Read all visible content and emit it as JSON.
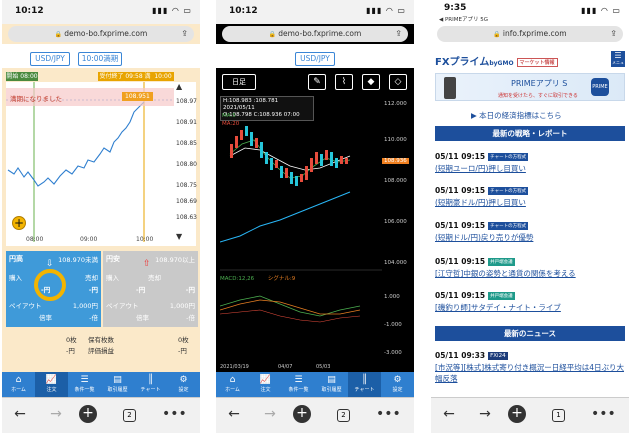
{
  "phone1": {
    "status_time": "10:12",
    "url": "demo-bo.fxprime.com",
    "pair": "USD/JPY",
    "period": "10:00満期",
    "open_label": "開始 08:00",
    "close_label": "受付終了 09:58 満期",
    "close_time": "10:00",
    "notice": "満期になりました",
    "current_price": "108.951",
    "y_ticks": [
      "108.97",
      "108.91",
      "108.85",
      "108.80",
      "108.75",
      "108.69",
      "108.63"
    ],
    "x_ticks": [
      "08:00",
      "09:00",
      "10:00"
    ],
    "high": {
      "title": "円高",
      "price": "108.970未満",
      "buy_label": "購入",
      "sell_label": "売却",
      "buy_value": "-円",
      "sell_value": "-円",
      "payout_label": "ペイアウト",
      "payout_value": "1,000円",
      "rate_label": "倍率",
      "rate_value": "-倍"
    },
    "low": {
      "title": "円安",
      "price": "108.970以上",
      "buy_label": "購入",
      "sell_label": "売却",
      "buy_value": "-円",
      "sell_value": "-円",
      "payout_label": "ペイアウト",
      "payout_value": "1,000円",
      "rate_label": "倍率",
      "rate_value": "-倍"
    },
    "summary": {
      "count_left": "0枚",
      "holding_label": "保有枚数",
      "count_right": "0枚",
      "amount_left": "-円",
      "valuation_label": "評価損益",
      "amount_right": "-円"
    },
    "nav": [
      "ホーム",
      "注文",
      "条件一覧",
      "取引履歴",
      "チャート",
      "設定"
    ]
  },
  "phone2": {
    "status_time": "10:12",
    "url": "demo-bo.fxprime.com",
    "pair": "USD/JPY",
    "period_button": "日足",
    "ohlc": {
      "h": "H:108.983",
      "l": ":108.781",
      "date": "2021/05/11",
      "o": "O:108.798",
      "c": "C:108.936",
      "time": "07:00"
    },
    "ma5": "MA:5",
    "ma20": "MA:20",
    "y_ticks": [
      "112.000",
      "110.000",
      "108.000",
      "106.000",
      "104.000",
      "1.000",
      "-1.000",
      "-3.000"
    ],
    "current_tag": "108.936",
    "macd_label": "MACD:12,26",
    "signal_label": "シグナル:9",
    "x_ticks": [
      "2021/03/19",
      "04/07",
      "05/03"
    ],
    "nav": [
      "ホーム",
      "注文",
      "条件一覧",
      "取引履歴",
      "チャート",
      "設定"
    ]
  },
  "phone3": {
    "status_time": "9:35",
    "status_sub": "◀ PRIMEアプリ 5G",
    "url": "info.fxprime.com",
    "logo": "FXプライム",
    "logo_gmo": "byGMO",
    "logo_badge": "マーケット情報",
    "menu": "メニュー",
    "banner_title": "PRIMEアプリ S",
    "banner_sub": "通知を受けたら、すぐに取引できる",
    "banner_icon": "PRIME",
    "link": "▶ 本日の経済指標はこちら",
    "section1": "最新の戦略・レポート",
    "section2": "最新のニュース",
    "items": [
      {
        "dt": "05/11 09:15",
        "tag": "チャートの方程式",
        "title": "(短期ユーロ/円)押し目買い"
      },
      {
        "dt": "05/11 09:15",
        "tag": "チャートの方程式",
        "title": "(短期豪ドル/円)押し目買い"
      },
      {
        "dt": "05/11 09:15",
        "tag": "チャートの方程式",
        "title": "(短期ドル/円)戻り売りが優勢"
      },
      {
        "dt": "05/11 09:15",
        "tag": "井戸端会議",
        "title": "[江守哲]中銀の姿勢と通貨の関係を考える"
      },
      {
        "dt": "05/11 09:15",
        "tag": "井戸端会議",
        "title": "[磯釣り師]サタデイ・ナイト・ライブ"
      }
    ],
    "news": {
      "dt": "05/11 09:33",
      "tag": "FXi24",
      "title": "[市況等][株式]株式寄り付き概況ー日経平均は4日ぶり大幅反落"
    }
  },
  "tab_count": "2",
  "tab_count3": "1"
}
